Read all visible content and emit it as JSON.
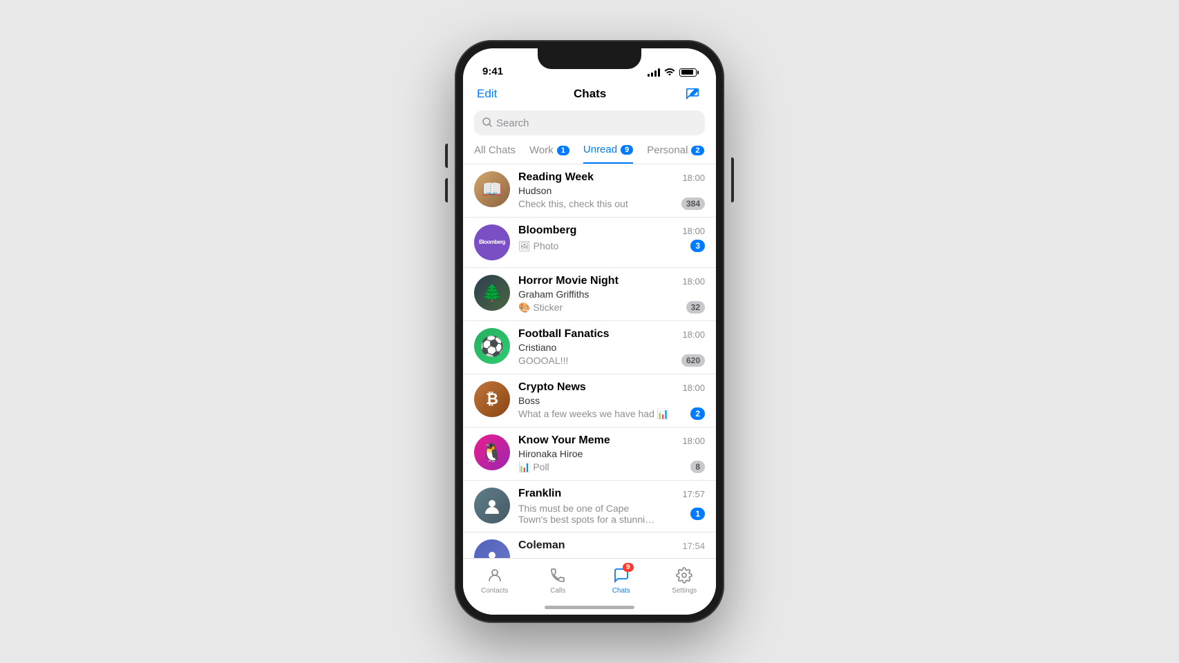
{
  "status_bar": {
    "time": "9:41"
  },
  "header": {
    "edit_label": "Edit",
    "title": "Chats"
  },
  "search": {
    "placeholder": "Search"
  },
  "filter_tabs": [
    {
      "id": "all",
      "label": "All Chats",
      "badge": null,
      "active": false
    },
    {
      "id": "work",
      "label": "Work",
      "badge": "1",
      "active": false
    },
    {
      "id": "unread",
      "label": "Unread",
      "badge": "9",
      "active": true
    },
    {
      "id": "personal",
      "label": "Personal",
      "badge": "2",
      "active": false
    }
  ],
  "chats": [
    {
      "id": "reading_week",
      "name": "Reading Week",
      "sender": "Hudson",
      "preview": "Check this, check this out",
      "time": "18:00",
      "unread": "384",
      "unread_type": "gray",
      "avatar_type": "image",
      "avatar_color": "reading",
      "avatar_emoji": "📚"
    },
    {
      "id": "bloomberg",
      "name": "Bloomberg",
      "sender": "",
      "preview": "🖼 Photo",
      "time": "18:00",
      "unread": "3",
      "unread_type": "blue",
      "avatar_type": "text",
      "avatar_color": "bloomberg",
      "avatar_text": "Bloomberg"
    },
    {
      "id": "horror_movie",
      "name": "Horror Movie Night",
      "sender": "Graham Griffiths",
      "preview": "🎨 Sticker",
      "time": "18:00",
      "unread": "32",
      "unread_type": "gray",
      "avatar_type": "emoji",
      "avatar_color": "horror",
      "avatar_emoji": "🌲"
    },
    {
      "id": "football_fanatics",
      "name": "Football Fanatics",
      "sender": "Cristiano",
      "preview": "GOOOAL!!!",
      "time": "18:00",
      "unread": "620",
      "unread_type": "gray",
      "avatar_type": "emoji",
      "avatar_color": "football",
      "avatar_emoji": "⚽"
    },
    {
      "id": "crypto_news",
      "name": "Crypto News",
      "sender": "Boss",
      "preview": "What a few weeks we have had 📊",
      "time": "18:00",
      "unread": "2",
      "unread_type": "blue",
      "avatar_type": "emoji",
      "avatar_color": "crypto",
      "avatar_emoji": "₿"
    },
    {
      "id": "know_your_meme",
      "name": "Know Your Meme",
      "sender": "Hironaka Hiroe",
      "preview": "📊 Poll",
      "time": "18:00",
      "unread": "8",
      "unread_type": "gray",
      "avatar_type": "emoji",
      "avatar_color": "meme",
      "avatar_emoji": "🐧"
    },
    {
      "id": "franklin",
      "name": "Franklin",
      "sender": "",
      "preview": "This must be one of Cape Town's best spots for a stunning view of...",
      "time": "17:57",
      "unread": "1",
      "unread_type": "blue",
      "avatar_type": "emoji",
      "avatar_color": "franklin",
      "avatar_emoji": "👤"
    },
    {
      "id": "coleman",
      "name": "Coleman",
      "sender": "",
      "preview": "",
      "time": "17:54",
      "unread": "",
      "unread_type": "none",
      "avatar_type": "emoji",
      "avatar_color": "coleman",
      "avatar_emoji": "👤"
    }
  ],
  "tab_bar": {
    "items": [
      {
        "id": "contacts",
        "label": "Contacts",
        "icon": "contacts",
        "active": false,
        "badge": null
      },
      {
        "id": "calls",
        "label": "Calls",
        "icon": "calls",
        "active": false,
        "badge": null
      },
      {
        "id": "chats",
        "label": "Chats",
        "icon": "chats",
        "active": true,
        "badge": "9"
      },
      {
        "id": "settings",
        "label": "Settings",
        "icon": "settings",
        "active": false,
        "badge": null
      }
    ]
  }
}
